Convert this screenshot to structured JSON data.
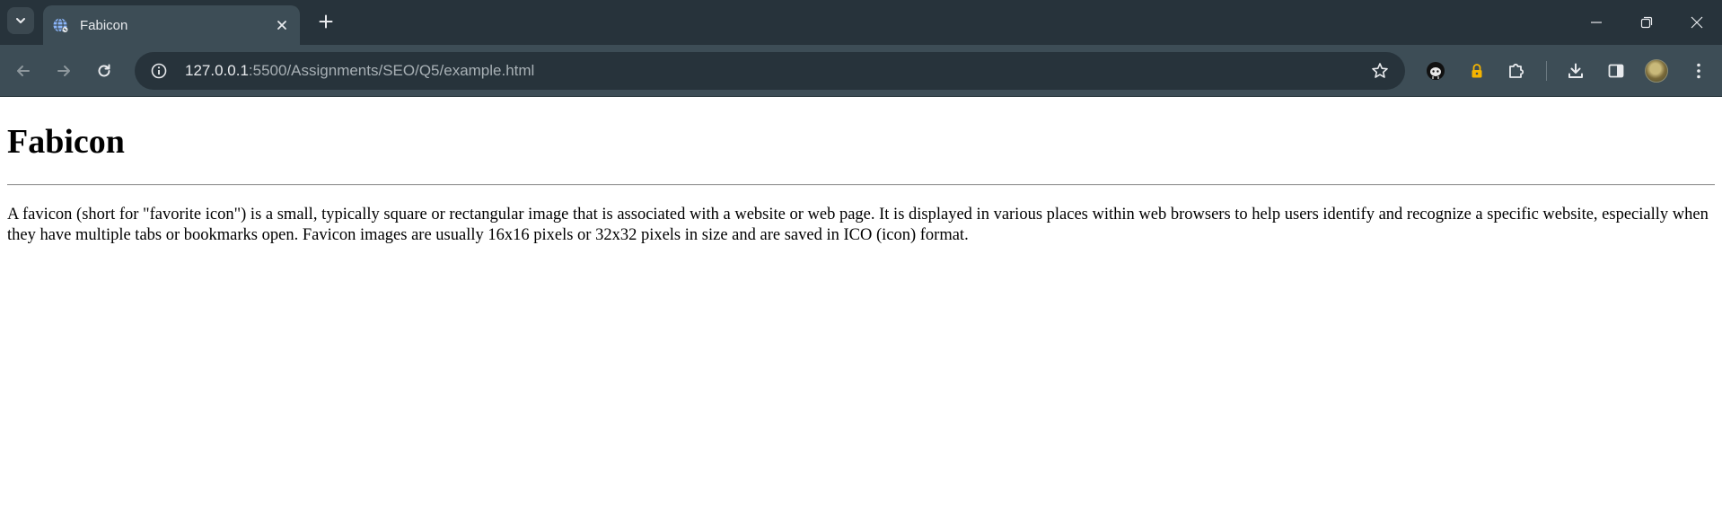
{
  "tab": {
    "title": "Fabicon"
  },
  "address_bar": {
    "url_host": "127.0.0.1",
    "url_rest": ":5500/Assignments/SEO/Q5/example.html"
  },
  "page": {
    "heading": "Fabicon",
    "paragraph": "A favicon (short for \"favorite icon\") is a small, typically square or rectangular image that is associated with a website or web page. It is displayed in various places within web browsers to help users identify and recognize a specific website, especially when they have multiple tabs or bookmarks open. Favicon images are usually 16x16 pixels or 32x32 pixels in size and are saved in ICO (icon) format."
  },
  "icons": {
    "tab_search": "chevron-down-icon",
    "favicon": "globe-icon",
    "tab_close": "close-icon",
    "new_tab": "plus-icon",
    "minimize": "minimize-icon",
    "restore": "restore-icon",
    "close_window": "close-icon",
    "back": "arrow-left-icon",
    "forward": "arrow-right-icon",
    "reload": "reload-icon",
    "site_info": "info-icon",
    "bookmark": "star-icon",
    "extension_1": "octocat-icon",
    "extension_2": "lock-icon",
    "extensions": "puzzle-icon",
    "downloads": "download-icon",
    "side_panel": "side-panel-icon",
    "profile": "avatar",
    "menu": "kebab-menu-icon"
  },
  "colors": {
    "tabstrip_bg": "#27333b",
    "toolbar_bg": "#3d4d56",
    "omnibox_bg": "#27333b",
    "page_bg": "#ffffff"
  }
}
